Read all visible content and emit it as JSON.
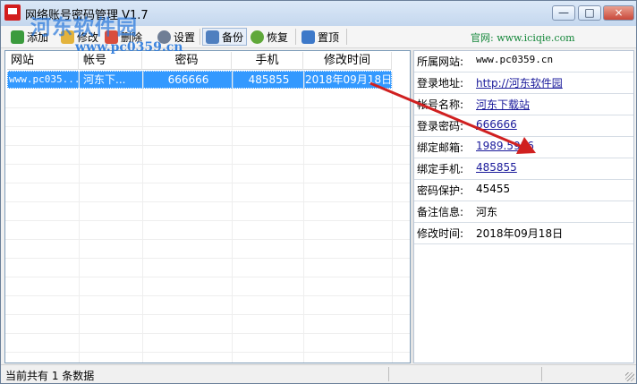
{
  "window": {
    "title": "网络账号密码管理 V1.7",
    "watermark_text": "河东软件园",
    "watermark_url": "www.pc0359.cn",
    "controls": {
      "minimize": "—",
      "maximize": "□",
      "close": "×"
    }
  },
  "toolbar": {
    "items": [
      {
        "label": "添加",
        "icon": "add-icon"
      },
      {
        "label": "修改",
        "icon": "edit-icon"
      },
      {
        "label": "删除",
        "icon": "delete-icon"
      },
      {
        "label": "设置",
        "icon": "settings-icon"
      },
      {
        "label": "备份",
        "icon": "backup-icon"
      },
      {
        "label": "恢复",
        "icon": "restore-icon"
      },
      {
        "label": "置顶",
        "icon": "pin-top-icon"
      }
    ],
    "site_link": "官网: www.iciqie.com"
  },
  "table": {
    "columns": [
      "网站",
      "帐号",
      "密码",
      "手机",
      "修改时间"
    ],
    "rows": [
      {
        "site": "www.pc035...",
        "account": "河东下...",
        "password": "666666",
        "phone": "485855",
        "modified": "2018年09月18日"
      }
    ]
  },
  "details": {
    "fields": [
      {
        "label": "所属网站:",
        "value": "www.pc0359.cn",
        "link": false
      },
      {
        "label": "登录地址:",
        "value": "http://河东软件园",
        "link": true
      },
      {
        "label": "帐号名称:",
        "value": "河东下载站",
        "link": true
      },
      {
        "label": "登录密码:",
        "value": "666666",
        "link": true
      },
      {
        "label": "绑定邮箱:",
        "value": "1989.5986",
        "link": true
      },
      {
        "label": "绑定手机:",
        "value": "485855",
        "link": true
      },
      {
        "label": "密码保护:",
        "value": "45455",
        "link": false
      },
      {
        "label": "备注信息:",
        "value": "河东",
        "link": false
      },
      {
        "label": "修改时间:",
        "value": "2018年09月18日",
        "link": false
      }
    ]
  },
  "status": {
    "text": "当前共有 1 条数据"
  },
  "colors": {
    "selection": "#3399ff",
    "link": "#1a1a9b",
    "site_link": "#14873a",
    "arrow": "#d02020"
  }
}
